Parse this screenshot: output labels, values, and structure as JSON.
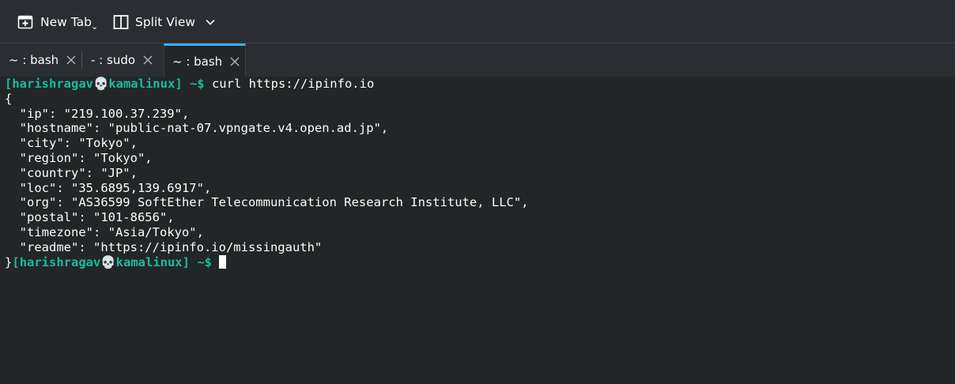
{
  "toolbar": {
    "new_tab_label": "New Tab",
    "split_view_label": "Split View"
  },
  "tabs": [
    {
      "label": "~ : bash",
      "active": false
    },
    {
      "label": "- : sudo",
      "active": false
    },
    {
      "label": "~ : bash",
      "active": true
    }
  ],
  "terminal": {
    "prompt_open": "[",
    "prompt_user": "harishragav",
    "prompt_skull": "💀",
    "prompt_host": "kamalinux",
    "prompt_close": "] ~$",
    "command": " curl https://ipinfo.io",
    "output": [
      "{",
      "  \"ip\": \"219.100.37.239\",",
      "  \"hostname\": \"public-nat-07.vpngate.v4.open.ad.jp\",",
      "  \"city\": \"Tokyo\",",
      "  \"region\": \"Tokyo\",",
      "  \"country\": \"JP\",",
      "  \"loc\": \"35.6895,139.6917\",",
      "  \"org\": \"AS36599 SoftEther Telecommunication Research Institute, LLC\",",
      "  \"postal\": \"101-8656\",",
      "  \"timezone\": \"Asia/Tokyo\",",
      "  \"readme\": \"https://ipinfo.io/missingauth\""
    ],
    "last_line_prefix": "}"
  },
  "colors": {
    "background": "#232627",
    "prompt": "#1abc9c",
    "active_tab_accent": "#3daee9"
  }
}
